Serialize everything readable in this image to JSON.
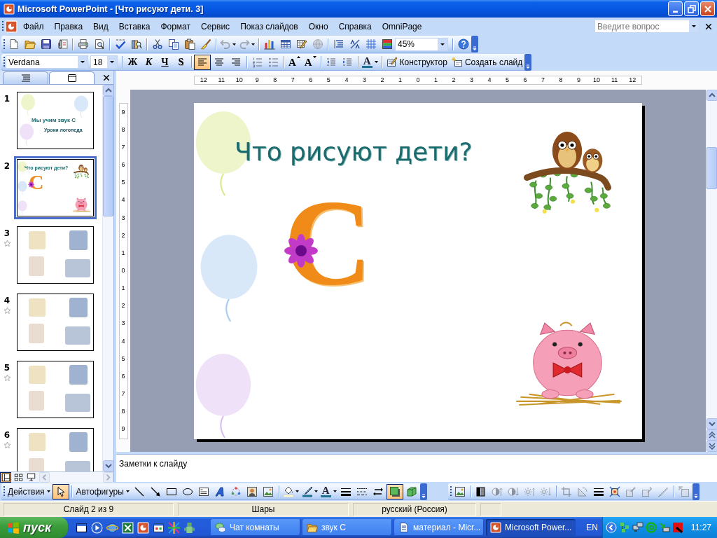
{
  "window": {
    "title": "Microsoft PowerPoint - [Что рисуют дети. 3]"
  },
  "menu": {
    "items": [
      "Файл",
      "Правка",
      "Вид",
      "Вставка",
      "Формат",
      "Сервис",
      "Показ слайдов",
      "Окно",
      "Справка",
      "OmniPage"
    ],
    "help_search": {
      "placeholder": "Введите вопрос"
    }
  },
  "standard_toolbar": {
    "undo": {
      "disabled": true
    },
    "redo": {
      "disabled": true
    },
    "hyperlink": {
      "disabled": true
    },
    "zoom": "45%"
  },
  "formatting_toolbar": {
    "font": "Verdana",
    "size": "18",
    "style_buttons": [
      "Ж",
      "К",
      "Ч",
      "S"
    ],
    "alignment": [
      {
        "selected": true
      },
      {
        "selected": false
      },
      {
        "selected": false
      }
    ],
    "font_size_buttons": [
      "A",
      "A"
    ],
    "font_color": "A",
    "designer": "Конструктор",
    "new_slide": "Создать слайд"
  },
  "slides_panel": {
    "tabs": [
      {
        "selected": false
      },
      {
        "selected": true
      }
    ],
    "slides": [
      {
        "number": "1",
        "kind": "title",
        "title": "Мы учим звук С",
        "subtitle": "Уроки логопеда",
        "selected": false,
        "animated": false
      },
      {
        "number": "2",
        "kind": "content",
        "title": "Что рисуют дети?",
        "letter": "С",
        "selected": true,
        "animated": false
      },
      {
        "number": "3",
        "kind": "pictures",
        "selected": false,
        "animated": true
      },
      {
        "number": "4",
        "kind": "pictures",
        "selected": false,
        "animated": true
      },
      {
        "number": "5",
        "kind": "pictures",
        "selected": false,
        "animated": true
      },
      {
        "number": "6",
        "kind": "pictures",
        "selected": false,
        "animated": true
      }
    ],
    "view_buttons": [
      {
        "selected": true
      },
      {
        "selected": false
      },
      {
        "selected": false
      }
    ]
  },
  "rulers": {
    "horizontal": [
      "12",
      "11",
      "10",
      "9",
      "8",
      "7",
      "6",
      "5",
      "4",
      "3",
      "2",
      "1",
      "0",
      "1",
      "2",
      "3",
      "4",
      "5",
      "6",
      "7",
      "8",
      "9",
      "10",
      "11",
      "12"
    ],
    "vertical": [
      "9",
      "8",
      "7",
      "6",
      "5",
      "4",
      "3",
      "2",
      "1",
      "0",
      "1",
      "2",
      "3",
      "4",
      "5",
      "6",
      "7",
      "8",
      "9"
    ]
  },
  "slide": {
    "title": "Что рисуют дети?",
    "letter": "С"
  },
  "notes": {
    "placeholder": "Заметки к слайду"
  },
  "drawing_toolbar": {
    "actions": "Действия",
    "pointer": {
      "selected": true
    },
    "autoshapes": "Автофигуры",
    "font_color": "A",
    "effects": [
      {
        "selected": true
      },
      {
        "selected": false
      }
    ]
  },
  "picture_toolbar": {
    "tools": [
      {
        "disabled": false
      },
      {
        "disabled": false
      },
      {
        "disabled": true
      },
      {
        "disabled": true
      },
      {
        "disabled": true
      },
      {
        "disabled": true
      },
      {
        "disabled": true
      },
      {
        "disabled": true
      },
      {
        "disabled": false
      },
      {
        "disabled": false
      },
      {
        "disabled": true
      },
      {
        "disabled": true
      },
      {
        "disabled": true
      },
      {
        "disabled": true
      }
    ]
  },
  "status_bar": {
    "cells": [
      "Слайд 2 из 9",
      "Шары",
      "русский (Россия)"
    ]
  },
  "taskbar": {
    "start": "пуск",
    "tasks": [
      {
        "label": "Чат комнаты",
        "selected": false
      },
      {
        "label": "звук С",
        "selected": false
      },
      {
        "label": "материал - Micr...",
        "selected": false
      },
      {
        "label": "Microsoft Power...",
        "selected": true
      }
    ],
    "language": "EN",
    "clock": "11:27"
  }
}
